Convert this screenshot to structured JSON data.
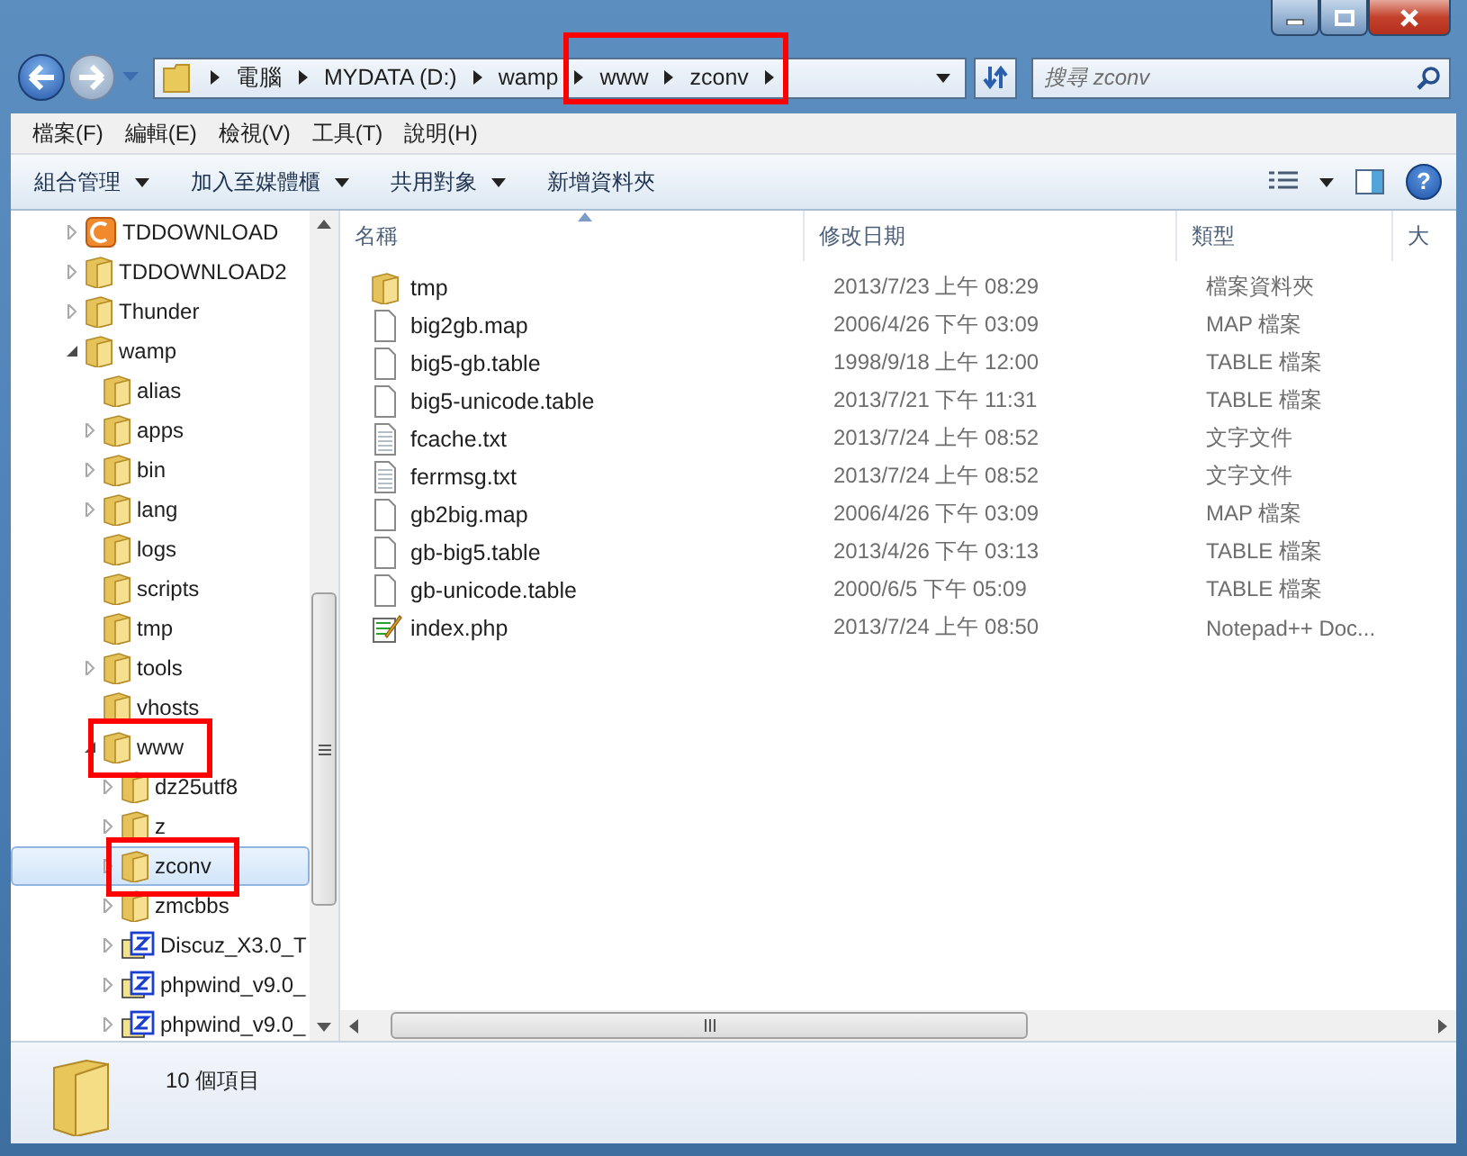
{
  "address_bar": {
    "segments": [
      {
        "label": "電腦",
        "highlighted": false
      },
      {
        "label": "MYDATA (D:)",
        "highlighted": false
      },
      {
        "label": "wamp",
        "highlighted": false
      },
      {
        "label": "www",
        "highlighted": true
      },
      {
        "label": "zconv",
        "highlighted": true
      }
    ]
  },
  "help_button": "?",
  "search": {
    "placeholder": "搜尋 zconv"
  },
  "menu": [
    "檔案(F)",
    "編輯(E)",
    "檢視(V)",
    "工具(T)",
    "說明(H)"
  ],
  "toolbar": [
    {
      "label": "組合管理",
      "dropdown": true
    },
    {
      "label": "加入至媒體櫃",
      "dropdown": true
    },
    {
      "label": "共用對象",
      "dropdown": true
    },
    {
      "label": "新增資料夾",
      "dropdown": false
    }
  ],
  "tree": [
    {
      "label": "TDDOWNLOAD",
      "kind": "app",
      "expandable": true,
      "expanded": false,
      "selected": false,
      "highlighted": false
    },
    {
      "label": "TDDOWNLOAD2",
      "kind": "folder",
      "expandable": true,
      "expanded": false,
      "selected": false,
      "highlighted": false
    },
    {
      "label": "Thunder",
      "kind": "folder",
      "expandable": true,
      "expanded": false,
      "selected": false,
      "highlighted": false
    },
    {
      "label": "wamp",
      "kind": "folder",
      "expandable": true,
      "expanded": true,
      "selected": false,
      "highlighted": false,
      "children": [
        {
          "label": "alias",
          "kind": "folder",
          "expandable": false,
          "selected": false,
          "highlighted": false
        },
        {
          "label": "apps",
          "kind": "folder",
          "expandable": true,
          "expanded": false,
          "selected": false,
          "highlighted": false
        },
        {
          "label": "bin",
          "kind": "folder",
          "expandable": true,
          "expanded": false,
          "selected": false,
          "highlighted": false
        },
        {
          "label": "lang",
          "kind": "folder",
          "expandable": true,
          "expanded": false,
          "selected": false,
          "highlighted": false
        },
        {
          "label": "logs",
          "kind": "folder",
          "expandable": false,
          "selected": false,
          "highlighted": false
        },
        {
          "label": "scripts",
          "kind": "folder",
          "expandable": false,
          "selected": false,
          "highlighted": false
        },
        {
          "label": "tmp",
          "kind": "folder",
          "expandable": false,
          "selected": false,
          "highlighted": false
        },
        {
          "label": "tools",
          "kind": "folder",
          "expandable": true,
          "expanded": false,
          "selected": false,
          "highlighted": false
        },
        {
          "label": "vhosts",
          "kind": "folder",
          "expandable": false,
          "selected": false,
          "highlighted": false
        },
        {
          "label": "www",
          "kind": "folder",
          "expandable": true,
          "expanded": true,
          "selected": false,
          "highlighted": true,
          "children": [
            {
              "label": "dz25utf8",
              "kind": "folder",
              "expandable": true,
              "expanded": false,
              "selected": false,
              "highlighted": false
            },
            {
              "label": "z",
              "kind": "folder",
              "expandable": true,
              "expanded": false,
              "selected": false,
              "highlighted": false
            },
            {
              "label": "zconv",
              "kind": "folder",
              "expandable": true,
              "expanded": false,
              "selected": true,
              "highlighted": true
            },
            {
              "label": "zmcbbs",
              "kind": "folder",
              "expandable": true,
              "expanded": false,
              "selected": false,
              "highlighted": false
            },
            {
              "label": "Discuz_X3.0_T",
              "kind": "archive",
              "expandable": true,
              "expanded": false,
              "selected": false,
              "highlighted": false
            },
            {
              "label": "phpwind_v9.0_",
              "kind": "archive",
              "expandable": true,
              "expanded": false,
              "selected": false,
              "highlighted": false
            },
            {
              "label": "phpwind_v9.0_",
              "kind": "archive",
              "expandable": true,
              "expanded": false,
              "selected": false,
              "highlighted": false
            }
          ]
        }
      ]
    }
  ],
  "columns": [
    {
      "label": "名稱",
      "sorted": true
    },
    {
      "label": "修改日期",
      "sorted": false
    },
    {
      "label": "類型",
      "sorted": false
    },
    {
      "label": "大",
      "sorted": false
    }
  ],
  "files": [
    {
      "name": "tmp",
      "date": "2013/7/23 上午 08:29",
      "type": "檔案資料夾",
      "kind": "folder"
    },
    {
      "name": "big2gb.map",
      "date": "2006/4/26 下午 03:09",
      "type": "MAP 檔案",
      "kind": "file"
    },
    {
      "name": "big5-gb.table",
      "date": "1998/9/18 上午 12:00",
      "type": "TABLE 檔案",
      "kind": "file"
    },
    {
      "name": "big5-unicode.table",
      "date": "2013/7/21 下午 11:31",
      "type": "TABLE 檔案",
      "kind": "file"
    },
    {
      "name": "fcache.txt",
      "date": "2013/7/24 上午 08:52",
      "type": "文字文件",
      "kind": "text"
    },
    {
      "name": "ferrmsg.txt",
      "date": "2013/7/24 上午 08:52",
      "type": "文字文件",
      "kind": "text"
    },
    {
      "name": "gb2big.map",
      "date": "2006/4/26 下午 03:09",
      "type": "MAP 檔案",
      "kind": "file"
    },
    {
      "name": "gb-big5.table",
      "date": "2013/4/26 下午 03:13",
      "type": "TABLE 檔案",
      "kind": "file"
    },
    {
      "name": "gb-unicode.table",
      "date": "2000/6/5 下午 05:09",
      "type": "TABLE 檔案",
      "kind": "file"
    },
    {
      "name": "index.php",
      "date": "2013/7/24 上午 08:50",
      "type": "Notepad++ Doc...",
      "kind": "script"
    }
  ],
  "status": "10 個項目"
}
